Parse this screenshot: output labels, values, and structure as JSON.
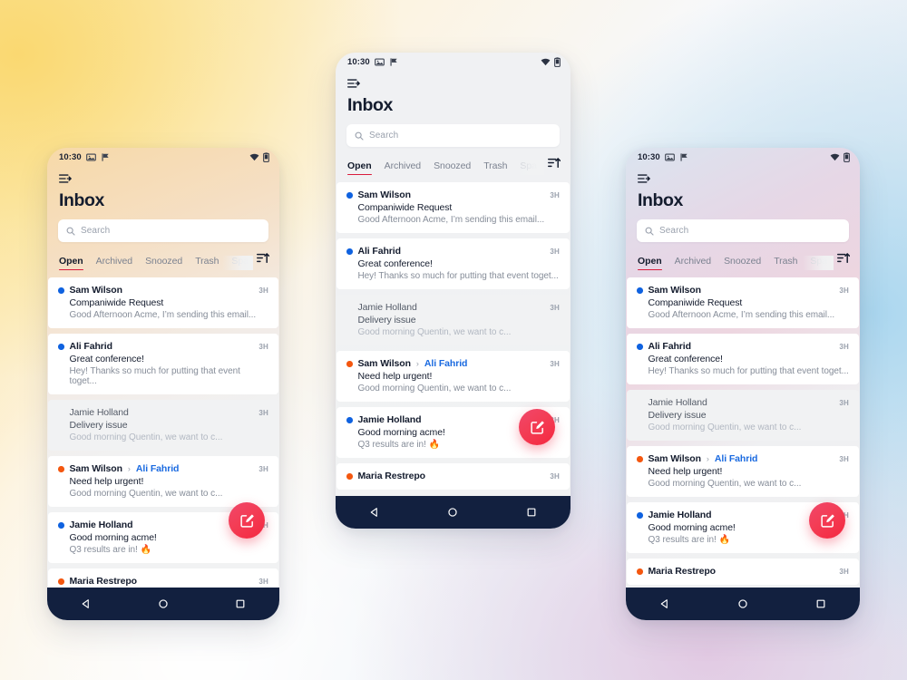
{
  "background": {
    "gradient_colors": [
      "#fbe39a",
      "#fdf3de",
      "#f7f8fa",
      "#e6eef6",
      "#a8d6ef",
      "#e2c4e0"
    ]
  },
  "accent_colors": {
    "unread_blue": "#0f62e0",
    "unread_orange": "#f4570f",
    "tab_underline_red": "#d91c3c",
    "link_blue": "#1a6ae0",
    "fab_gradient_from": "#f0476b",
    "fab_gradient_to": "#f5273f",
    "navbar": "#12203f"
  },
  "statusbar": {
    "time": "10:30",
    "icons_left": [
      "photo-icon",
      "flag-icon"
    ],
    "icons_right": [
      "wifi-icon",
      "battery-icon"
    ]
  },
  "header": {
    "menu_icon": "menu-open-icon",
    "title": "Inbox"
  },
  "search": {
    "icon": "search-icon",
    "placeholder": "Search"
  },
  "tabs": {
    "items": [
      {
        "label": "Open",
        "active": true,
        "faded": false
      },
      {
        "label": "Archived",
        "active": false,
        "faded": false
      },
      {
        "label": "Snoozed",
        "active": false,
        "faded": false
      },
      {
        "label": "Trash",
        "active": false,
        "faded": false
      },
      {
        "label": "Spa",
        "active": false,
        "faded": true
      }
    ],
    "sort_icon": "sort-ascending-icon"
  },
  "fab": {
    "icon": "compose-icon"
  },
  "navbar": {
    "buttons": [
      {
        "icon": "back-triangle-icon"
      },
      {
        "icon": "home-circle-icon"
      },
      {
        "icon": "recents-square-icon"
      }
    ]
  },
  "emails": [
    {
      "dot": "blue",
      "sender": "Sam Wilson",
      "sender2": "",
      "time": "3H",
      "subject": "Companiwide Request",
      "preview": "Good Afternoon Acme, I’m sending this email...",
      "read": false
    },
    {
      "dot": "blue",
      "sender": "Ali Fahrid",
      "sender2": "",
      "time": "3H",
      "subject": "Great conference!",
      "preview": "Hey! Thanks so much for putting that event toget...",
      "read": false
    },
    {
      "dot": "none",
      "sender": "Jamie Holland",
      "sender2": "",
      "time": "3H",
      "subject": "Delivery issue",
      "preview": "Good morning Quentin, we want to c...",
      "read": true
    },
    {
      "dot": "orange",
      "sender": "Sam Wilson",
      "sender2": "Ali Fahrid",
      "time": "3H",
      "subject": "Need help urgent!",
      "preview": "Good morning Quentin, we want to c...",
      "read": false
    },
    {
      "dot": "blue",
      "sender": "Jamie Holland",
      "sender2": "",
      "time": "3H",
      "subject": "Good morning acme!",
      "preview": "Q3 results are in! 🔥",
      "read": false
    },
    {
      "dot": "orange",
      "sender": "Maria Restrepo",
      "sender2": "",
      "time": "3H",
      "subject": "",
      "preview": "",
      "read": false
    }
  ]
}
